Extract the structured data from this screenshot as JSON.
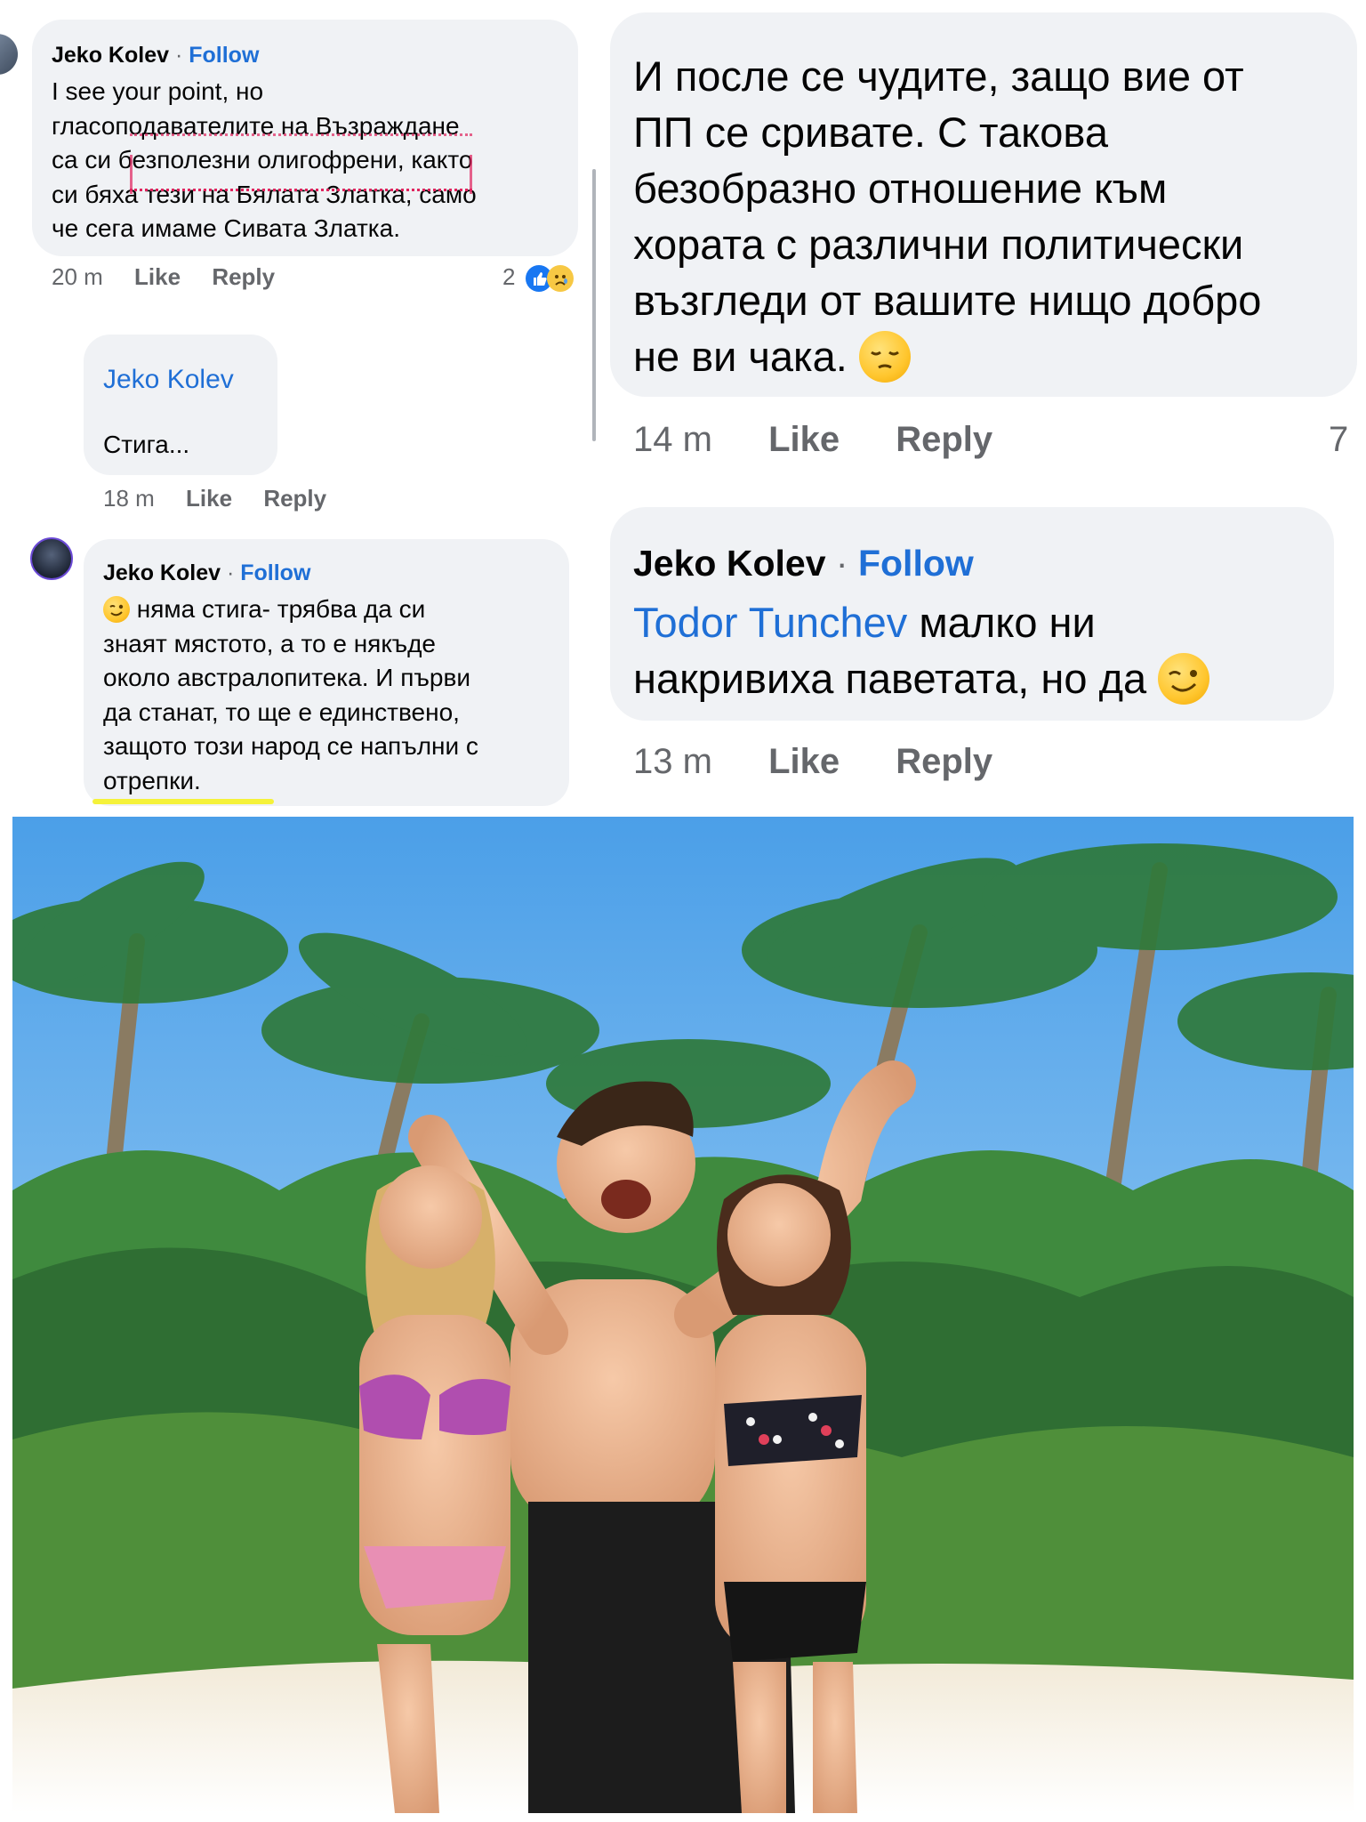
{
  "left_col": {
    "c1": {
      "author": "Jeko Kolev",
      "separator": "·",
      "follow": "Follow",
      "lines": [
        "I see your point, но",
        "гласоподавателите на Възраждане",
        "са си безполезни олигофрени, както",
        "си бяха тези на Бялата Златка, само",
        "че сега имаме Сивата Златка."
      ],
      "time": "20 m",
      "like": "Like",
      "reply": "Reply",
      "reaction_count": "2",
      "reaction_icons": [
        "like-icon",
        "sad-icon"
      ]
    },
    "c2": {
      "mention": "Jeko Kolev",
      "text": "Стига...",
      "time": "18 m",
      "like": "Like",
      "reply": "Reply"
    },
    "c3": {
      "author": "Jeko Kolev",
      "separator": "·",
      "follow": "Follow",
      "emoji": "winking-face-icon",
      "lines": [
        " няма стига- трябва да си",
        "знаят мястото, а то е някъде",
        "около австралопитека. И първи",
        "да станат, то ще е единствено,",
        "защото този народ се напълни с",
        "отрепки."
      ]
    }
  },
  "right_col": {
    "c4": {
      "lines": [
        "И после се чудите, защо вие от",
        "ПП се сривате. С такова",
        "безобразно отношение към",
        "хората с различни политически",
        "възгледи от вашите нищо добро",
        "не ви чака."
      ],
      "emoji": "pensive-face-icon",
      "time": "14 m",
      "like": "Like",
      "reply": "Reply",
      "reaction_count": "7"
    },
    "c5": {
      "author": "Jeko Kolev",
      "separator": "·",
      "follow": "Follow",
      "mention": "Todor Tunchev",
      "line1_rest": " малко ни",
      "line2": "накривиха паветата, но да",
      "emoji": "winking-face-icon",
      "time": "13 m",
      "like": "Like",
      "reply": "Reply"
    }
  },
  "colors": {
    "bubble": "#f0f2f5",
    "follow_blue": "#1f6fd6",
    "meta_gray": "#65676b",
    "spell_red": "#e0245e",
    "highlight_yellow": "#f5f23a"
  }
}
